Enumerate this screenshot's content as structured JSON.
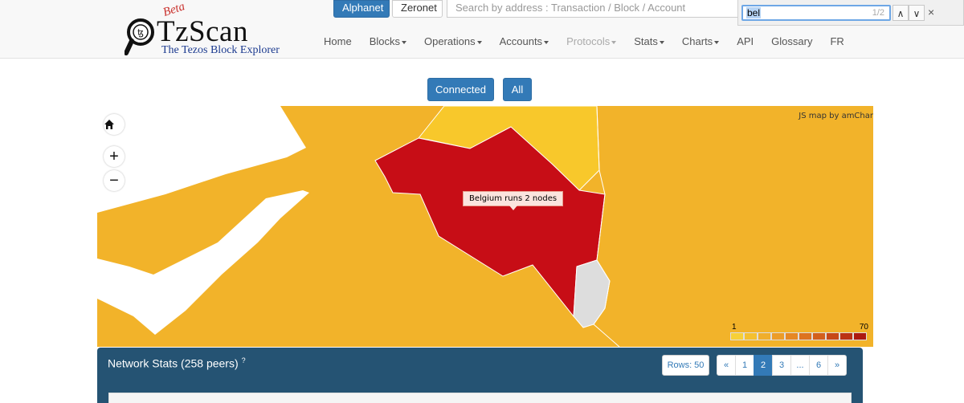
{
  "header": {
    "logo": {
      "beta": "Beta",
      "name": "TzScan",
      "subtitle": "The Tezos Block Explorer"
    },
    "networks": [
      {
        "label": "Alphanet",
        "active": true
      },
      {
        "label": "Zeronet",
        "active": false
      }
    ],
    "search": {
      "placeholder": "Search by address : Transaction / Block / Account"
    },
    "nav": [
      {
        "label": "Home",
        "dropdown": false,
        "disabled": false
      },
      {
        "label": "Blocks",
        "dropdown": true,
        "disabled": false
      },
      {
        "label": "Operations",
        "dropdown": true,
        "disabled": false
      },
      {
        "label": "Accounts",
        "dropdown": true,
        "disabled": false
      },
      {
        "label": "Protocols",
        "dropdown": true,
        "disabled": true
      },
      {
        "label": "Stats",
        "dropdown": true,
        "disabled": false
      },
      {
        "label": "Charts",
        "dropdown": true,
        "disabled": false
      },
      {
        "label": "API",
        "dropdown": false,
        "disabled": false
      },
      {
        "label": "Glossary",
        "dropdown": false,
        "disabled": false
      },
      {
        "label": "FR",
        "dropdown": false,
        "disabled": false
      }
    ]
  },
  "findbar": {
    "query": "bel",
    "count": "1/2",
    "up_icon": "chevron-up-icon",
    "down_icon": "chevron-down-icon",
    "close": "×"
  },
  "filters": {
    "connected_label": "Connected",
    "all_label": "All"
  },
  "map": {
    "credit": "JS map by amChar",
    "tooltip": "Belgium runs 2 nodes",
    "legend_min": "1",
    "legend_max": "70",
    "highlight_color": "#c70d16",
    "base_color": "#f2b32a",
    "light_color": "#f8c82b",
    "nodata_color": "#dddddd",
    "legend_colors": [
      "#f7d038",
      "#f4c030",
      "#f0ae2c",
      "#ec9c28",
      "#e68824",
      "#dd7320",
      "#d3601c",
      "#c74918",
      "#bb3214",
      "#ad1a10"
    ],
    "controls": {
      "home_icon": "home-icon",
      "zoom_in": "+",
      "zoom_out": "−"
    }
  },
  "network_stats": {
    "title": "Network Stats (258 peers)",
    "help": "?",
    "rows_label": "Rows: 50",
    "pagination": [
      "«",
      "1",
      "2",
      "3",
      "...",
      "6",
      "»"
    ],
    "active_page": "2"
  }
}
